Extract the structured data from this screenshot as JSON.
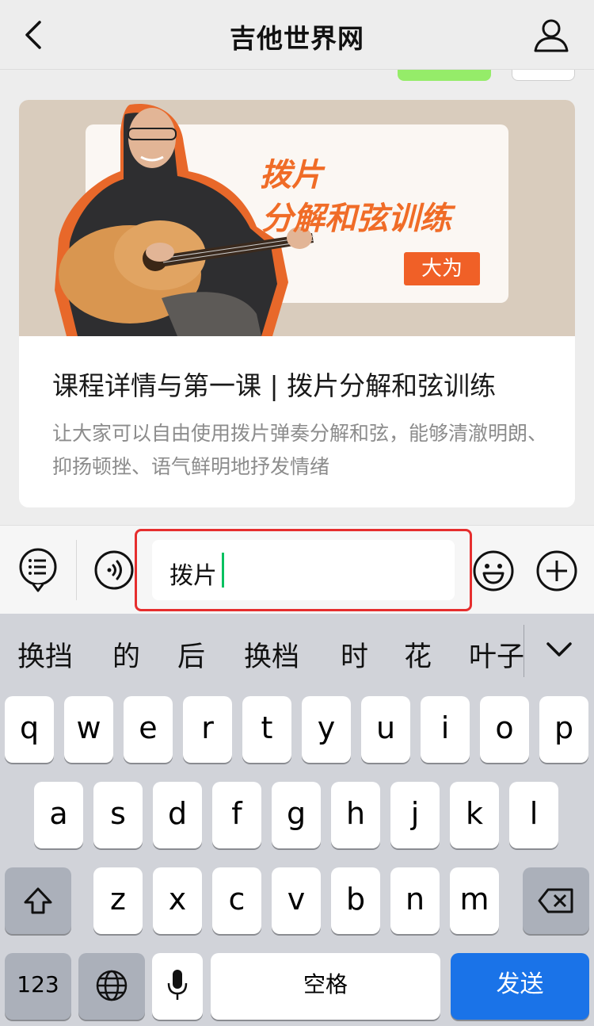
{
  "header": {
    "title": "吉他世界网"
  },
  "card": {
    "banner_title_line1": "拨片",
    "banner_title_line2": "分解和弦训练",
    "banner_badge": "大为",
    "title": "课程详情与第一课 | 拨片分解和弦训练",
    "description": "让大家可以自由使用拨片弹奏分解和弦，能够清澈明朗、抑扬顿挫、语气鲜明地抒发情绪"
  },
  "input": {
    "value": "拨片"
  },
  "keyboard": {
    "suggestions": [
      "换挡",
      "的",
      "后",
      "换档",
      "时",
      "花",
      "叶子"
    ],
    "row1": [
      "q",
      "w",
      "e",
      "r",
      "t",
      "y",
      "u",
      "i",
      "o",
      "p"
    ],
    "row2": [
      "a",
      "s",
      "d",
      "f",
      "g",
      "h",
      "j",
      "k",
      "l"
    ],
    "row3": [
      "z",
      "x",
      "c",
      "v",
      "b",
      "n",
      "m"
    ],
    "numbers_key": "123",
    "space_key": "空格",
    "send_key": "发送"
  },
  "colors": {
    "accent": "#07c160",
    "send": "#1a73e8",
    "banner_orange": "#f06c27",
    "highlight": "#e62e2e"
  },
  "icons": [
    "back-arrow-icon",
    "user-icon",
    "menu-list-icon",
    "voice-icon",
    "emoji-icon",
    "plus-icon",
    "chevron-down-icon",
    "shift-icon",
    "delete-icon",
    "globe-icon",
    "microphone-icon"
  ]
}
